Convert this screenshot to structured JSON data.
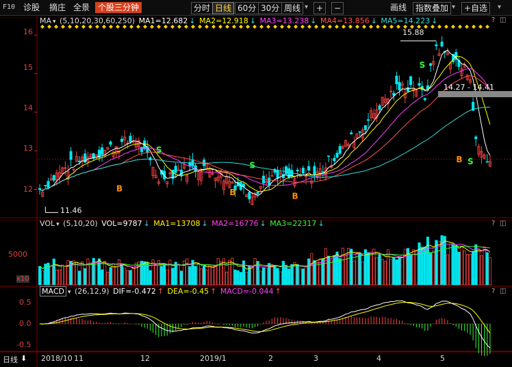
{
  "toolbar": {
    "f10": "F10",
    "diagnose": "诊股",
    "pick": "摘庄",
    "full": "全景",
    "three_min": "个股三分钟",
    "tab_intraday": "分时",
    "tab_daily": "日线",
    "tab_60": "60分",
    "tab_30": "30分",
    "tab_weekly": "周线",
    "zoom_in": "+",
    "zoom_out": "−",
    "draw_line": "画线",
    "index_overlay": "指数叠加",
    "self_select": "+自选",
    "active_tab": "日线"
  },
  "price_pane": {
    "legend_name": "MA",
    "legend_params": "(5,10,20,30,60,250)",
    "ma1": "MA1=12.682",
    "ma2": "MA2=12.918",
    "ma3": "MA3=13.238",
    "ma4": "MA4=13.856",
    "ma5": "MA5=14.223",
    "y_ticks": [
      "16",
      "15",
      "14",
      "13",
      "12"
    ],
    "high_label": "15.88",
    "low_label": "11.46",
    "range_label": "14.27 - 14.41",
    "buy_marker": "B",
    "sell_marker": "S"
  },
  "volume_pane": {
    "legend_name": "VOL",
    "legend_params": "(5,10,20)",
    "vol": "VOL=9787",
    "ma1": "MA1=13708",
    "ma2": "MA2=16776",
    "ma3": "MA3=22317",
    "y_ticks": [
      "5000",
      "x10"
    ]
  },
  "macd_pane": {
    "legend_name": "MACD",
    "legend_params": "(26,12,9)",
    "dif": "DIF=-0.472",
    "dea": "DEA=-0.45",
    "macd": "MACD=-0.044",
    "y_ticks": [
      "0.5",
      "0.0",
      "-0.5"
    ]
  },
  "x_axis": {
    "period_label": "日线",
    "ticks": [
      "2018/10",
      "11",
      "12",
      "2019/1",
      "2",
      "3",
      "4",
      "5"
    ]
  },
  "colors": {
    "up": "#ff4444",
    "down": "#00e5ee",
    "ma1": "#ffffff",
    "ma2": "#ffff00",
    "ma3": "#ff44ff",
    "ma4": "#ff5555",
    "ma5": "#33dddd",
    "axis": "#e04040"
  },
  "chart_data": {
    "type": "line",
    "title": "",
    "ylim": [
      11.3,
      16.2
    ],
    "x": [
      "2018/10",
      "11",
      "12",
      "2019/1",
      "2",
      "3",
      "4",
      "5"
    ],
    "series": [
      {
        "name": "MA1",
        "values": [
          12.1,
          12.9,
          12.3,
          12.0,
          12.5,
          14.1,
          15.5,
          12.7
        ]
      },
      {
        "name": "MA2",
        "values": [
          12.2,
          12.8,
          12.5,
          12.1,
          12.3,
          13.6,
          15.2,
          12.9
        ]
      },
      {
        "name": "MA3",
        "values": [
          12.4,
          12.7,
          12.6,
          12.2,
          12.2,
          13.2,
          14.9,
          13.2
        ]
      },
      {
        "name": "MA4",
        "values": [
          12.5,
          12.7,
          12.7,
          12.3,
          12.2,
          13.0,
          14.6,
          13.9
        ]
      },
      {
        "name": "MA5",
        "values": [
          12.6,
          12.7,
          12.6,
          12.5,
          12.3,
          12.7,
          13.8,
          14.2
        ]
      }
    ]
  }
}
